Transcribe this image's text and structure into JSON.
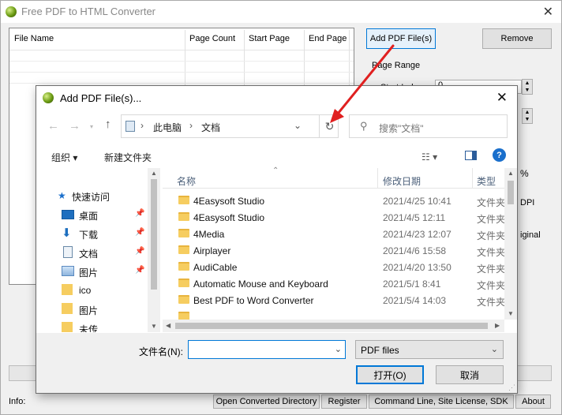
{
  "main": {
    "title": "Free PDF to HTML Converter",
    "columns": [
      "File Name",
      "Page Count",
      "Start Page",
      "End Page"
    ],
    "add_button": "Add PDF File(s)",
    "remove_button": "Remove",
    "page_range_label": "Page Range",
    "start_index_label": "Start Index:",
    "start_index_value": "0",
    "partial_percent": "%",
    "partial_dpi": "DPI",
    "partial_original": "iginal",
    "info_label": "Info:",
    "bottom_buttons": [
      "Open Converted Directory",
      "Register",
      "Command Line, Site License, SDK",
      "About"
    ]
  },
  "dialog": {
    "title": "Add PDF File(s)...",
    "breadcrumb": [
      "此电脑",
      "文档"
    ],
    "search_placeholder": "搜索\"文档\"",
    "toolbar": {
      "organize": "组织 ▾",
      "new_folder": "新建文件夹"
    },
    "nav_items": [
      {
        "label": "快速访问",
        "icon": "star-icon"
      },
      {
        "label": "桌面",
        "icon": "desktop-icon",
        "pinned": true
      },
      {
        "label": "下载",
        "icon": "download-icon",
        "pinned": true
      },
      {
        "label": "文档",
        "icon": "document-icon",
        "pinned": true
      },
      {
        "label": "图片",
        "icon": "picture-icon",
        "pinned": true
      },
      {
        "label": "ico",
        "icon": "folder-icon"
      },
      {
        "label": "图片",
        "icon": "folder-icon"
      },
      {
        "label": "未传",
        "icon": "folder-icon"
      }
    ],
    "columns": {
      "name": "名称",
      "date": "修改日期",
      "type": "类型"
    },
    "files": [
      {
        "name": "4Easysoft Studio",
        "date": "2021/4/25 10:41",
        "type": "文件夹"
      },
      {
        "name": "4Easysoft Studio",
        "date": "2021/4/5 12:11",
        "type": "文件夹"
      },
      {
        "name": "4Media",
        "date": "2021/4/23 12:07",
        "type": "文件夹"
      },
      {
        "name": "Airplayer",
        "date": "2021/4/6 15:58",
        "type": "文件夹"
      },
      {
        "name": "AudiCable",
        "date": "2021/4/20 13:50",
        "type": "文件夹"
      },
      {
        "name": "Automatic Mouse and Keyboard",
        "date": "2021/5/1 8:41",
        "type": "文件夹"
      },
      {
        "name": "Best PDF to Word Converter",
        "date": "2021/5/4 14:03",
        "type": "文件夹"
      }
    ],
    "filename_label": "文件名(N):",
    "filename_value": "",
    "filetype_value": "PDF files",
    "open_button": "打开(O)",
    "cancel_button": "取消"
  },
  "colors": {
    "accent": "#0078d7",
    "annotation": "#e02020",
    "folder": "#f6cd60"
  }
}
